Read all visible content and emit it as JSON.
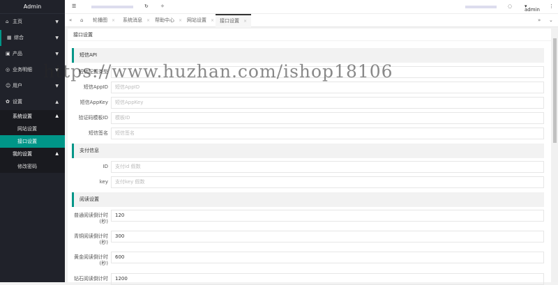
{
  "app": {
    "title": "Admin"
  },
  "sidebar": {
    "items": [
      {
        "label": "主页",
        "icon": "home-icon"
      },
      {
        "label": "综合",
        "icon": "grid-icon"
      },
      {
        "label": "产品",
        "icon": "box-icon"
      },
      {
        "label": "业务明细",
        "icon": "chart-icon"
      },
      {
        "label": "用户",
        "icon": "user-icon"
      },
      {
        "label": "设置",
        "icon": "gear-icon"
      }
    ],
    "settings_sub": {
      "group1": "系统设置",
      "g1_items": [
        "网站设置",
        "接口设置"
      ],
      "group2": "我的设置",
      "g2_items": [
        "修改密码"
      ]
    }
  },
  "topbar": {
    "user": "admin"
  },
  "tabs": [
    "轮播图",
    "系统消息",
    "帮助中心",
    "网站设置",
    "接口设置"
  ],
  "page_title": "接口设置",
  "sections": {
    "sms": {
      "title": "短信API",
      "fields": [
        {
          "label": "短信配置类型",
          "placeholder": ""
        },
        {
          "label": "短信AppID",
          "placeholder": "短信AppID"
        },
        {
          "label": "短信AppKey",
          "placeholder": "短信AppKey"
        },
        {
          "label": "验证码模板ID",
          "placeholder": "模板ID"
        },
        {
          "label": "短信签名",
          "placeholder": "短信签名"
        }
      ]
    },
    "pay": {
      "title": "支付信息",
      "fields": [
        {
          "label": "ID",
          "placeholder": "支付id 假数"
        },
        {
          "label": "key",
          "placeholder": "支付key 假数"
        }
      ]
    },
    "read": {
      "title": "阅读设置",
      "fields": [
        {
          "label": "普通阅读倒计时(秒)",
          "value": "120"
        },
        {
          "label": "青铜阅读倒计时(秒)",
          "value": "300"
        },
        {
          "label": "黄金阅读倒计时(秒)",
          "value": "600"
        },
        {
          "label": "钻石阅读倒计时",
          "value": "1200"
        }
      ]
    }
  },
  "watermark": "https://www.huzhan.com/ishop18106",
  "colors": {
    "accent": "#009688",
    "sidebar": "#20222a"
  }
}
